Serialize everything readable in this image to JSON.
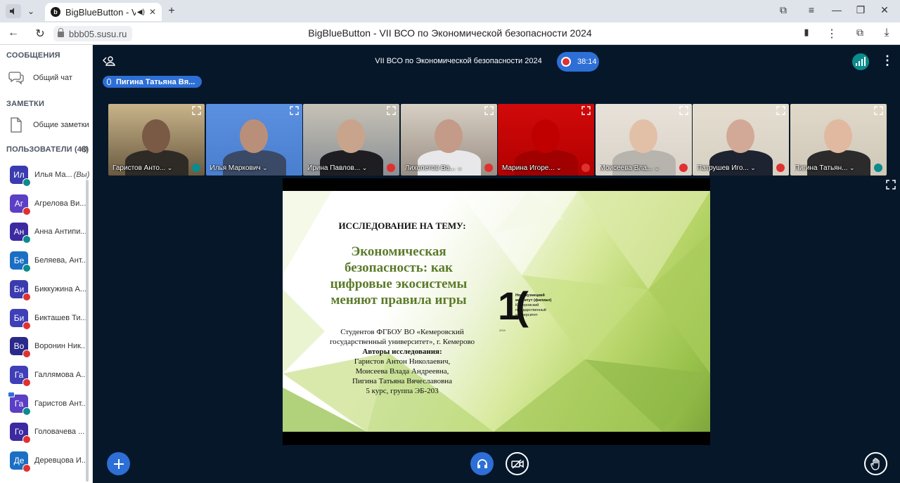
{
  "browser": {
    "tab_title": "BigBlueButton - VII В",
    "tab_favicon": "b",
    "url": "bbb05.susu.ru",
    "page_title": "BigBlueButton - VII ВСО по Экономической безопасности 2024"
  },
  "sidebar": {
    "messages_title": "СООБЩЕНИЯ",
    "public_chat": "Общий чат",
    "notes_title": "ЗАМЕТКИ",
    "shared_notes": "Общие заметки",
    "users_title": "ПОЛЬЗОВАТЕЛИ (48)",
    "users": [
      {
        "initials": "Ил",
        "name": "Илья Ма...",
        "you": "(Вы)",
        "color": "#3b3bb0",
        "status": "audio"
      },
      {
        "initials": "Аг",
        "name": "Агрелова Ви...",
        "color": "#5b3fc4",
        "status": "muted"
      },
      {
        "initials": "Ан",
        "name": "Анна Антипи...",
        "color": "#3b2aa0",
        "status": "audio"
      },
      {
        "initials": "Бе",
        "name": "Беляева, Ант...",
        "color": "#1a6fc4",
        "status": "audio"
      },
      {
        "initials": "Би",
        "name": "Биккужина А...",
        "color": "#3b3bb0",
        "status": "muted"
      },
      {
        "initials": "Би",
        "name": "Бикташев Ти...",
        "color": "#3f3fb8",
        "status": "muted"
      },
      {
        "initials": "Во",
        "name": "Воронин Ник...",
        "color": "#2a2a8a",
        "status": "muted"
      },
      {
        "initials": "Га",
        "name": "Галлямова А...",
        "color": "#3f3fb8",
        "status": "muted"
      },
      {
        "initials": "Га",
        "name": "Гаристов Ант...",
        "color": "#5b3fc4",
        "status": "audio",
        "presenter": true
      },
      {
        "initials": "Го",
        "name": "Головачева ...",
        "color": "#3b2aa0",
        "status": "muted"
      },
      {
        "initials": "Де",
        "name": "Деревцова И...",
        "color": "#1a6fc4",
        "status": "muted"
      }
    ]
  },
  "meeting": {
    "title": "VII ВСО по Экономической безопасности 2024",
    "recording_time": "38:14",
    "talking_indicator": "Пигина Татьяна Вя...",
    "videos": [
      {
        "name": "Гаристов Анто...",
        "mic": "on",
        "bg": "#6a5a40",
        "wall": "#c9b48a",
        "face": "#7a5a44",
        "shirt": "#2e2a26"
      },
      {
        "name": "Илья Маркович",
        "mic": "none",
        "bg": "#4a7fd0",
        "wall": "#5b8fe0",
        "face": "#b98f7a",
        "shirt": "#3a4a66"
      },
      {
        "name": "Ирина Павлов...",
        "mic": "off",
        "bg": "#8a8f95",
        "wall": "#c7c2b6",
        "face": "#c9a48c",
        "shirt": "#1e1e22"
      },
      {
        "name": "Лихолетов Ва...",
        "mic": "off",
        "bg": "#9a8f84",
        "wall": "#d8d0c4",
        "face": "#c49a88",
        "shirt": "#e8e8ea"
      },
      {
        "name": "Марина Игоре...",
        "mic": "off",
        "bg": "#b30000",
        "wall": "#d10a0a",
        "face": "#c00000",
        "shirt": "#a00000"
      },
      {
        "name": "Моисеева Вла...",
        "mic": "off",
        "bg": "#d9d2c8",
        "wall": "#e8e2da",
        "face": "#e2c0a8",
        "shirt": "#b7b4ae"
      },
      {
        "name": "Патрушев Иго...",
        "mic": "off",
        "bg": "#d6d0c2",
        "wall": "#e4ddd0",
        "face": "#d2a996",
        "shirt": "#1d2330"
      },
      {
        "name": "Пигина Татьян...",
        "mic": "on",
        "bg": "#cfc7b8",
        "wall": "#e0d8c8",
        "face": "#e0b9a0",
        "shirt": "#2b2b2b"
      }
    ]
  },
  "slide": {
    "heading": "ИССЛЕДОВАНИЕ НА ТЕМУ:",
    "title_lines": [
      "Экономическая",
      "безопасность: как",
      "цифровые экосистемы",
      "меняют правила игры"
    ],
    "students_line1": "Студентов ФГБОУ ВО «Кемеровский",
    "students_line2": "государственный  университет», г. Кемерово",
    "authors_label": "Авторы исследования:",
    "author1": "Гаристов Антон Николаевич,",
    "author2": "Моисеева Влада Андреевна,",
    "author3": "Пигина  Татьяна Вячеславовна",
    "group": "5 курс, группа ЭБ-203",
    "logo_line1": "Новокузнецкий",
    "logo_line2": "институт (филиал)",
    "logo_line3": "Кемеровский",
    "logo_line4": "государственный",
    "logo_line5": "университет",
    "logo_year": "2019"
  },
  "colors": {
    "accent": "#2d6fd6",
    "muted": "#e03131",
    "audio": "#0b8b8b",
    "meeting_bg": "#06172a"
  }
}
